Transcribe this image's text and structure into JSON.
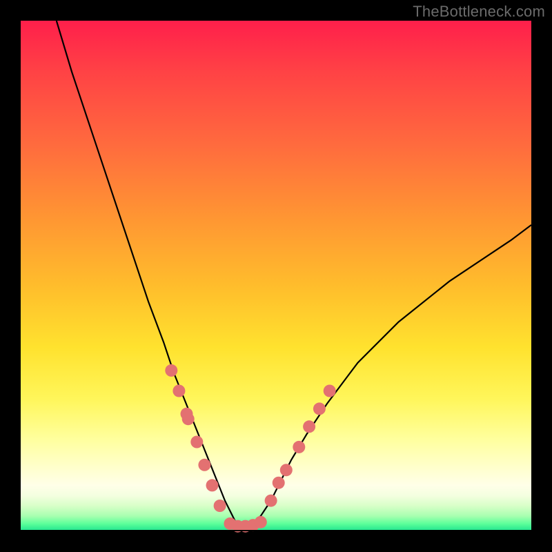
{
  "watermark": "TheBottleneck.com",
  "colors": {
    "marker": "#e37171",
    "curve": "#000000",
    "frame": "#000000"
  },
  "chart_data": {
    "type": "line",
    "title": "",
    "xlabel": "",
    "ylabel": "",
    "xlim": [
      0,
      100
    ],
    "ylim": [
      0,
      100
    ],
    "curve": {
      "name": "bottleneck-curve",
      "description": "V-shaped bottleneck curve; minimum near x≈43 at y≈0",
      "x": [
        7,
        10,
        14,
        18,
        22,
        25,
        28,
        30,
        32,
        34,
        36,
        38,
        40,
        42,
        43,
        45,
        47,
        49,
        51,
        53,
        56,
        60,
        66,
        74,
        84,
        96,
        100
      ],
      "y": [
        100,
        90,
        78,
        66,
        54,
        45,
        37,
        31,
        26,
        21,
        16,
        11,
        6,
        2,
        0,
        1,
        3,
        6,
        10,
        14,
        19,
        25,
        33,
        41,
        49,
        57,
        60
      ]
    },
    "series": [
      {
        "name": "markers-left",
        "type": "scatter",
        "x": [
          29.5,
          31.0,
          32.5,
          32.8,
          34.5,
          36.0,
          37.5,
          39.0
        ],
        "y": [
          31.5,
          27.5,
          23.0,
          22.0,
          17.5,
          13.0,
          9.0,
          5.0
        ]
      },
      {
        "name": "markers-bottom",
        "type": "scatter",
        "x": [
          41.0,
          42.5,
          44.0,
          45.5,
          47.0
        ],
        "y": [
          1.5,
          1.0,
          1.0,
          1.2,
          1.8
        ]
      },
      {
        "name": "markers-right",
        "type": "scatter",
        "x": [
          49.0,
          50.5,
          52.0,
          54.5,
          56.5,
          58.5,
          60.5
        ],
        "y": [
          6.0,
          9.5,
          12.0,
          16.5,
          20.5,
          24.0,
          27.5
        ]
      }
    ]
  }
}
